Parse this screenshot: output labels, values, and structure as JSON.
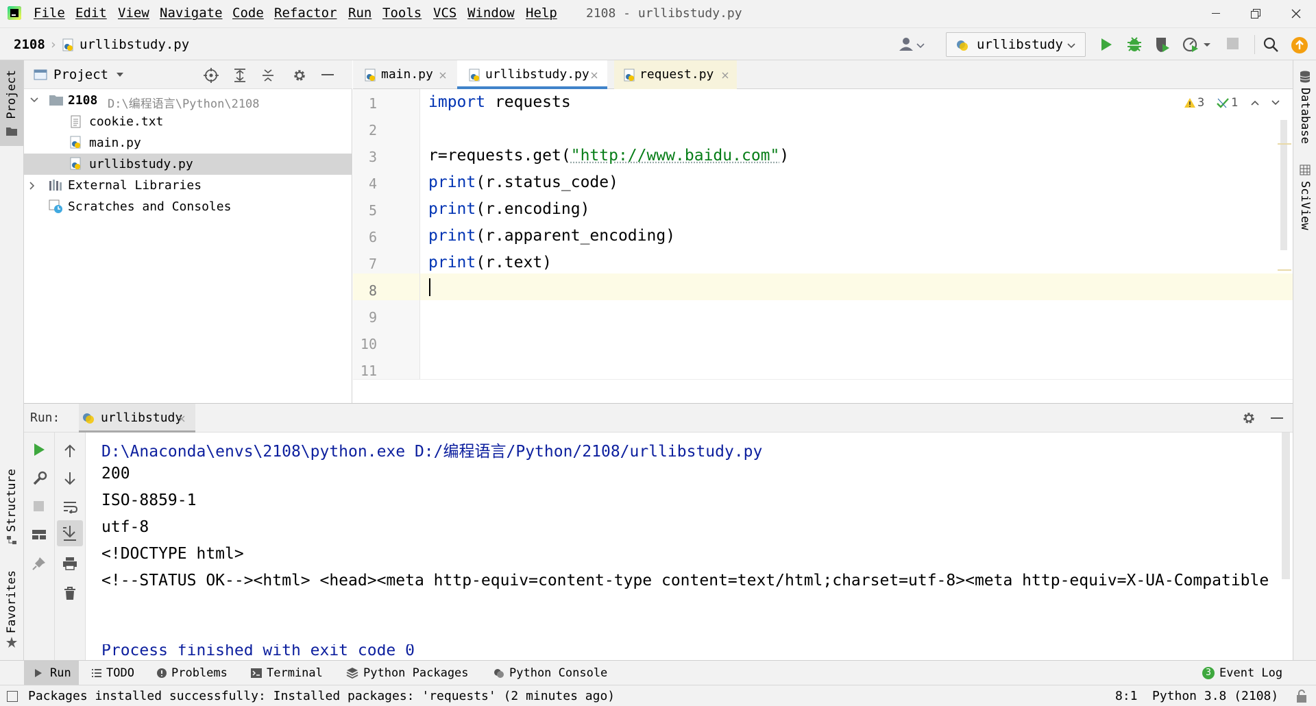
{
  "menubar": {
    "items": [
      "File",
      "Edit",
      "View",
      "Navigate",
      "Code",
      "Refactor",
      "Run",
      "Tools",
      "VCS",
      "Window",
      "Help"
    ],
    "window_title": "2108 - urllibstudy.py"
  },
  "navbar": {
    "project": "2108",
    "file": "urllibstudy.py",
    "run_config": "urllibstudy"
  },
  "project_panel": {
    "title": "Project",
    "root_name": "2108",
    "root_path": "D:\\编程语言\\Python\\2108",
    "files": [
      "cookie.txt",
      "main.py",
      "urllibstudy.py"
    ],
    "selected_file": "urllibstudy.py",
    "external": "External Libraries",
    "scratches": "Scratches and Consoles"
  },
  "left_strip": {
    "project": "Project",
    "structure": "Structure",
    "favorites": "Favorites"
  },
  "right_strip": {
    "database": "Database",
    "sciview": "SciView"
  },
  "editor": {
    "tabs": [
      "main.py",
      "urllibstudy.py",
      "request.py"
    ],
    "active_tab": "urllibstudy.py",
    "line_numbers": [
      "1",
      "2",
      "3",
      "4",
      "5",
      "6",
      "7",
      "8",
      "9",
      "10",
      "11"
    ],
    "code": {
      "l1_kw": "import",
      "l1_rest": " requests",
      "l3_pre": "r=requests.get(",
      "l3_str": "\"http://www.baidu.com\"",
      "l3_post": ")",
      "print": "print",
      "l4_args": "(r.status_code)",
      "l5_args": "(r.encoding)",
      "l6_args": "(r.apparent_encoding)",
      "l7_args": "(r.text)"
    },
    "warnings": "3",
    "weak_warnings": "1",
    "cursor_line": 8
  },
  "run_panel": {
    "label": "Run:",
    "tab": "urllibstudy",
    "output": [
      "D:\\Anaconda\\envs\\2108\\python.exe D:/编程语言/Python/2108/urllibstudy.py",
      "200",
      "ISO-8859-1",
      "utf-8",
      "<!DOCTYPE html>",
      "<!--STATUS OK--><html> <head><meta http-equiv=content-type content=text/html;charset=utf-8><meta http-equiv=X-UA-Compatible"
    ],
    "finished": "Process finished with exit code 0"
  },
  "bottom_tools": {
    "run": "Run",
    "todo": "TODO",
    "problems": "Problems",
    "terminal": "Terminal",
    "packages": "Python Packages",
    "console": "Python Console",
    "event_log": "Event Log",
    "event_count": "3"
  },
  "statusbar": {
    "message": "Packages installed successfully: Installed packages: 'requests' (2 minutes ago)",
    "position": "8:1",
    "interpreter": "Python 3.8 (2108)"
  },
  "colors": {
    "keyword": "#0033b3",
    "string": "#067d17",
    "current_line": "#fdfbe6",
    "run_green": "#3ea83e",
    "update_orange": "#f49f10"
  }
}
